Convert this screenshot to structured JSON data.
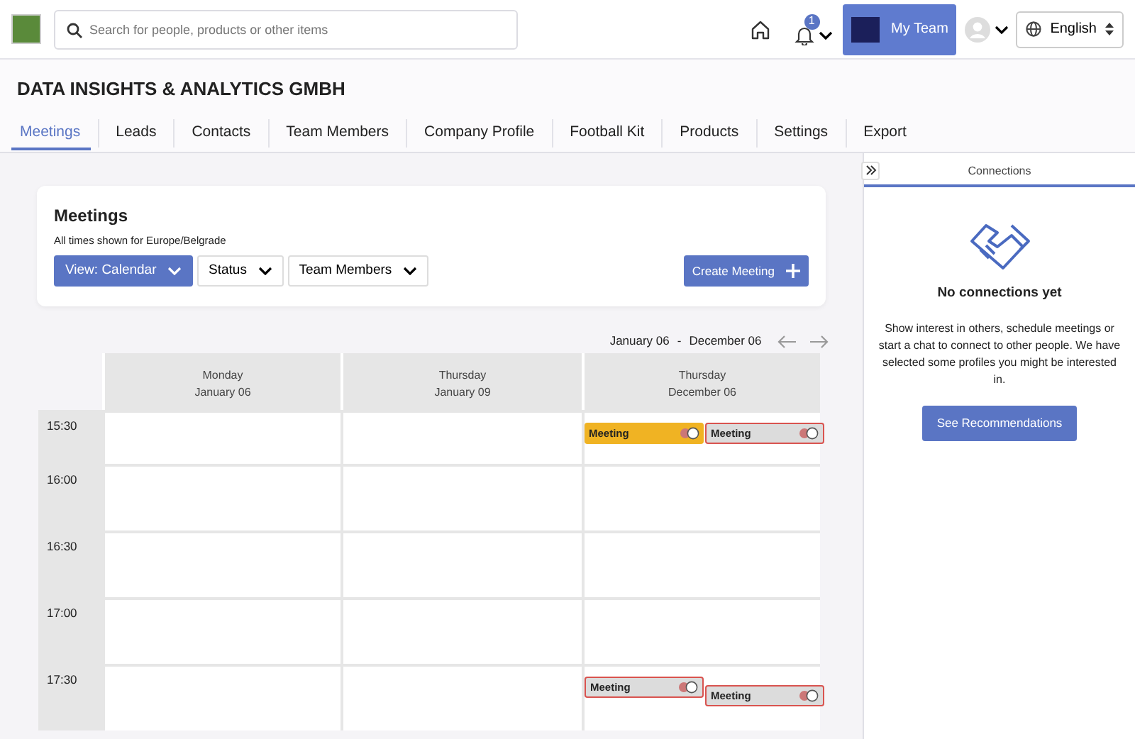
{
  "header": {
    "search": {
      "placeholder": "Search for people, products or other items"
    },
    "notifications": {
      "count": "1"
    },
    "team_button": {
      "label": "My Team"
    },
    "language": {
      "value": "English"
    }
  },
  "company": {
    "name": "DATA INSIGHTS & ANALYTICS GMBH"
  },
  "tabs": [
    {
      "label": "Meetings",
      "selected": true
    },
    {
      "label": "Leads",
      "selected": false
    },
    {
      "label": "Contacts",
      "selected": false
    },
    {
      "label": "Team Members",
      "selected": false
    },
    {
      "label": "Company Profile",
      "selected": false
    },
    {
      "label": "Football Kit",
      "selected": false
    },
    {
      "label": "Products",
      "selected": false
    },
    {
      "label": "Settings",
      "selected": false
    },
    {
      "label": "Export",
      "selected": false
    }
  ],
  "meetings_card": {
    "title": "Meetings",
    "timezone_note": "All times shown for",
    "timezone": "Europe/Belgrade",
    "filters": [
      "View: Calendar",
      "Status",
      "Team Members"
    ],
    "create_button": "Create Meeting"
  },
  "calendar": {
    "range_start": "January 06",
    "range_separator": "-",
    "range_end": "December 06",
    "days": [
      {
        "weekday": "Monday",
        "date": "January 06"
      },
      {
        "weekday": "Thursday",
        "date": "January 09"
      },
      {
        "weekday": "Thursday",
        "date": "December 06"
      }
    ],
    "rows": [
      {
        "time": "15:30",
        "cells": [
          {},
          {},
          {
            "events": [
              {
                "title": "Meeting",
                "color": "#f0b323",
                "flagged": false
              },
              {
                "title": "Meeting",
                "color": "#dcdcdc",
                "flagged": true
              }
            ]
          }
        ]
      },
      {
        "time": "16:00",
        "cells": [
          {},
          {},
          {}
        ]
      },
      {
        "time": "16:30",
        "cells": [
          {},
          {},
          {}
        ]
      },
      {
        "time": "17:00",
        "cells": [
          {},
          {},
          {}
        ]
      },
      {
        "time": "17:30",
        "cells": [
          {},
          {},
          {
            "events": [
              {
                "title": "Meeting",
                "color": "#dcdcdc",
                "flagged": true
              },
              {
                "title": "Meeting",
                "color": "#dcdcdc",
                "flagged": true
              }
            ]
          }
        ]
      }
    ]
  },
  "connections_panel": {
    "tab": "Connections",
    "heading": "No connections yet",
    "text": "Show interest in others, schedule meetings or start a chat to connect to other people. We have selected some profiles you might be interested in.",
    "button": "See Recommendations"
  }
}
